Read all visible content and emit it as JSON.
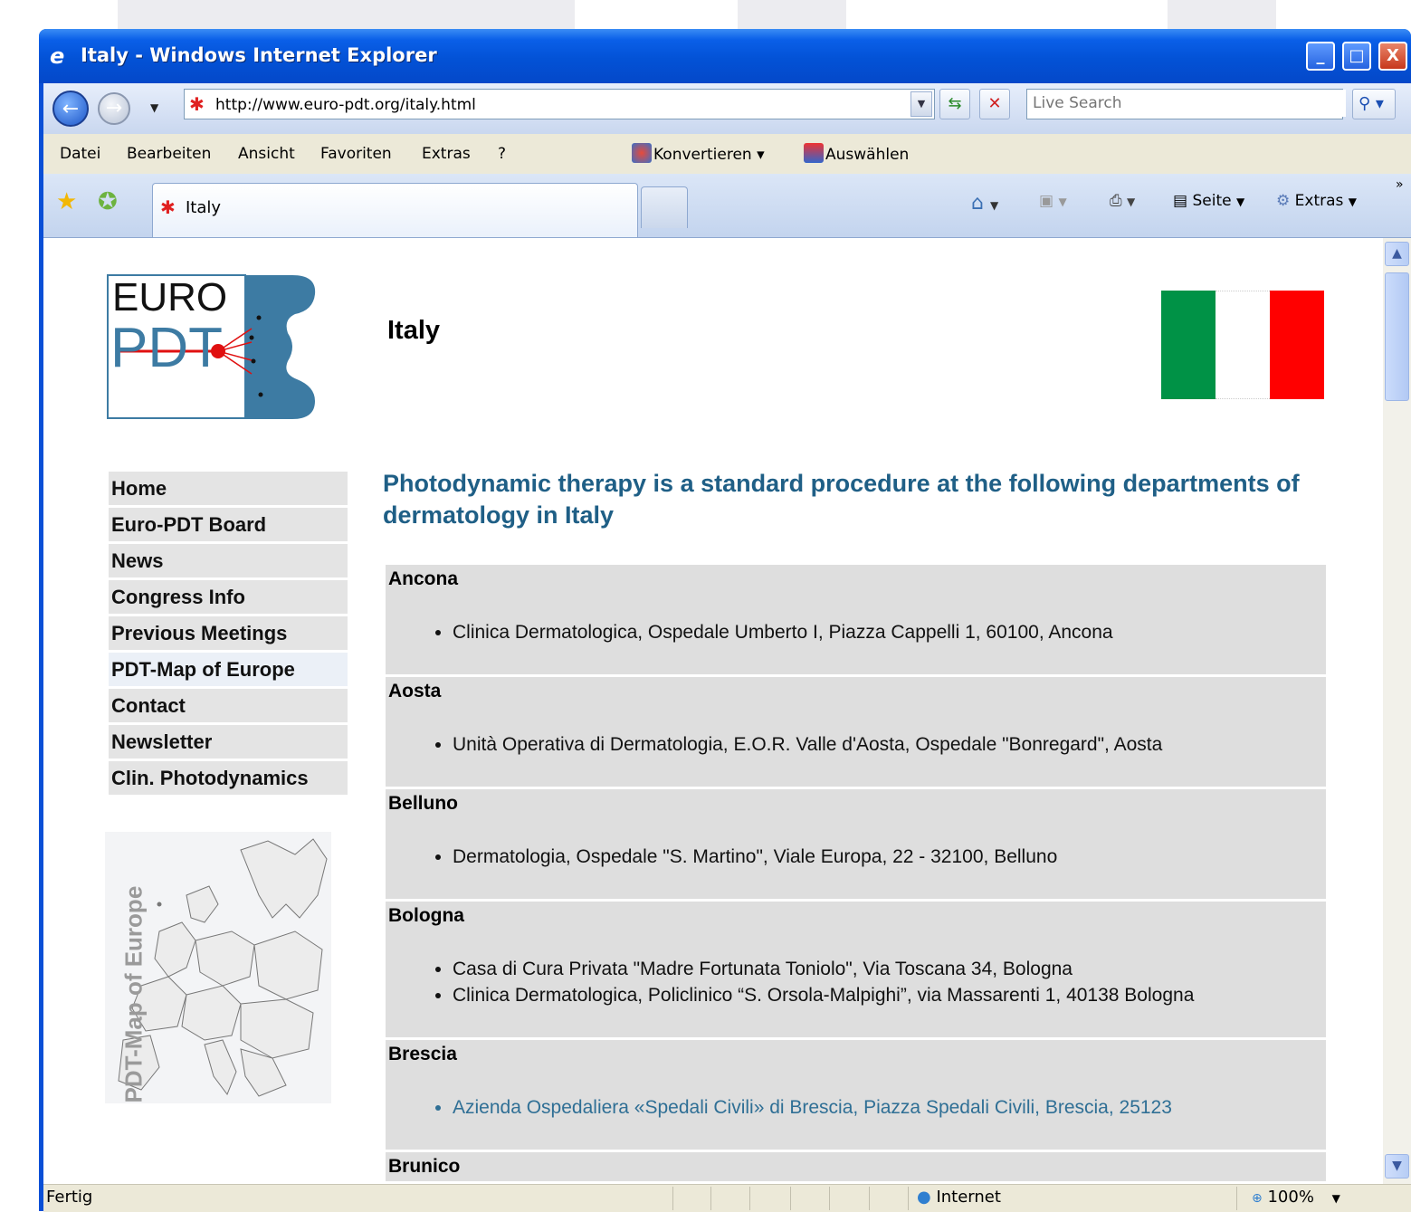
{
  "window": {
    "title": "Italy - Windows Internet Explorer",
    "controls": [
      "_",
      "□",
      "X"
    ]
  },
  "navigation": {
    "url": "http://www.euro-pdt.org/italy.html",
    "search_placeholder": "Live Search"
  },
  "menu": {
    "items": [
      "Datei",
      "Bearbeiten",
      "Ansicht",
      "Favoriten",
      "Extras",
      "?"
    ],
    "convert_label": "Konvertieren",
    "select_label": "Auswählen"
  },
  "tabs": {
    "active_tab_label": "Italy",
    "page_label": "Seite",
    "tools_label": "Extras"
  },
  "page": {
    "logo_text_top": "EURO",
    "logo_text_bottom": "PDT",
    "heading": "Italy",
    "flag_colors": [
      "#009246",
      "#ffffff",
      "#ff0000"
    ],
    "nav": [
      "Home",
      "Euro-PDT Board",
      "News",
      "Congress Info",
      "Previous Meetings",
      "PDT-Map of Europe",
      "Contact",
      "Newsletter",
      "Clin. Photodynamics"
    ],
    "map_label": "PDT-Map of Europe",
    "intro": "Photodynamic therapy is a standard procedure at the following departments of dermatology in Italy",
    "cities": [
      {
        "name": "Ancona",
        "entries": [
          "Clinica Dermatologica, Ospedale Umberto I, Piazza Cappelli 1, 60100, Ancona"
        ]
      },
      {
        "name": "Aosta",
        "entries": [
          "Unità Operativa di Dermatologia, E.O.R. Valle d'Aosta, Ospedale \"Bonregard\", Aosta"
        ]
      },
      {
        "name": "Belluno",
        "entries": [
          "Dermatologia, Ospedale \"S. Martino\", Viale Europa, 22 - 32100, Belluno"
        ]
      },
      {
        "name": "Bologna",
        "entries": [
          "Casa di Cura Privata \"Madre Fortunata Toniolo\", Via Toscana 34, Bologna",
          "Clinica Dermatologica, Policlinico “S. Orsola-Malpighi”, via Massarenti 1, 40138 Bologna"
        ]
      },
      {
        "name": "Brescia",
        "entries": [
          "Azienda Ospedaliera «Spedali Civili» di Brescia, Piazza Spedali Civili, Brescia, 25123"
        ]
      },
      {
        "name": "Brunico",
        "entries": []
      }
    ]
  },
  "status": {
    "text": "Fertig",
    "zone": "Internet",
    "zoom": "100%"
  }
}
